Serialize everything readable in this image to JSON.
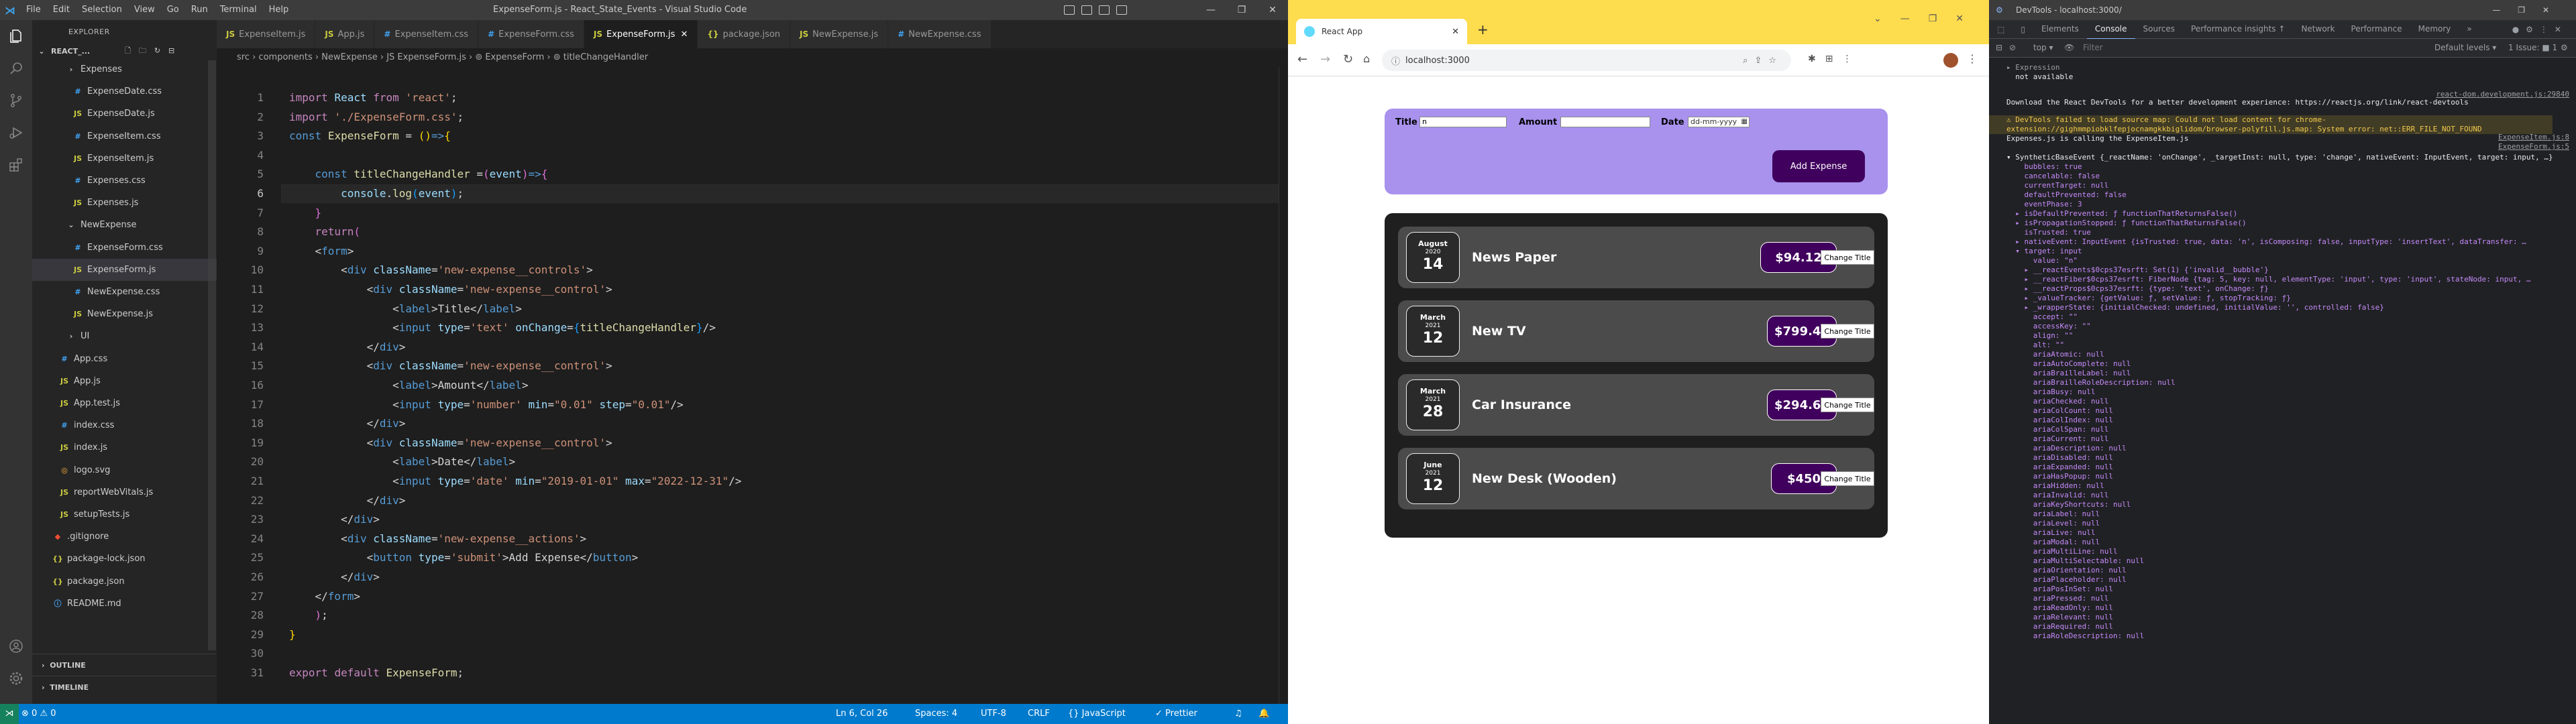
{
  "vscode": {
    "menus": [
      "File",
      "Edit",
      "Selection",
      "View",
      "Go",
      "Run",
      "Terminal",
      "Help"
    ],
    "title": "ExpenseForm.js - React_State_Events - Visual Studio Code",
    "explorer_title": "EXPLORER",
    "project": "REACT_...",
    "tree": [
      {
        "label": "Expenses",
        "type": "folder",
        "indent": 1
      },
      {
        "label": "ExpenseDate.css",
        "type": "css",
        "indent": 2
      },
      {
        "label": "ExpenseDate.js",
        "type": "js",
        "indent": 2
      },
      {
        "label": "ExpenseItem.css",
        "type": "css",
        "indent": 2
      },
      {
        "label": "ExpenseItem.js",
        "type": "js",
        "indent": 2
      },
      {
        "label": "Expenses.css",
        "type": "css",
        "indent": 2
      },
      {
        "label": "Expenses.js",
        "type": "js",
        "indent": 2
      },
      {
        "label": "NewExpense",
        "type": "folder-open",
        "indent": 1
      },
      {
        "label": "ExpenseForm.css",
        "type": "css",
        "indent": 2
      },
      {
        "label": "ExpenseForm.js",
        "type": "js",
        "indent": 2,
        "selected": true
      },
      {
        "label": "NewExpense.css",
        "type": "css",
        "indent": 2
      },
      {
        "label": "NewExpense.js",
        "type": "js",
        "indent": 2
      },
      {
        "label": "UI",
        "type": "folder",
        "indent": 1
      },
      {
        "label": "App.css",
        "type": "css",
        "indent": 0
      },
      {
        "label": "App.js",
        "type": "js",
        "indent": 0
      },
      {
        "label": "App.test.js",
        "type": "js",
        "indent": 0
      },
      {
        "label": "index.css",
        "type": "css",
        "indent": 0
      },
      {
        "label": "index.js",
        "type": "js",
        "indent": 0
      },
      {
        "label": "logo.svg",
        "type": "svg",
        "indent": 0
      },
      {
        "label": "reportWebVitals.js",
        "type": "js",
        "indent": 0
      },
      {
        "label": "setupTests.js",
        "type": "js",
        "indent": 0
      },
      {
        "label": ".gitignore",
        "type": "git",
        "indent": -1
      },
      {
        "label": "package-lock.json",
        "type": "json",
        "indent": -1
      },
      {
        "label": "package.json",
        "type": "json",
        "indent": -1
      },
      {
        "label": "README.md",
        "type": "md",
        "indent": -1
      }
    ],
    "outline": "OUTLINE",
    "timeline": "TIMELINE",
    "tabs": [
      {
        "label": "ExpenseItem.js",
        "type": "js"
      },
      {
        "label": "App.js",
        "type": "js"
      },
      {
        "label": "ExpenseItem.css",
        "type": "css"
      },
      {
        "label": "ExpenseForm.css",
        "type": "css"
      },
      {
        "label": "ExpenseForm.js",
        "type": "js",
        "active": true
      },
      {
        "label": "package.json",
        "type": "json"
      },
      {
        "label": "NewExpense.js",
        "type": "js"
      },
      {
        "label": "NewExpense.css",
        "type": "css"
      }
    ],
    "breadcrumb": "src › components › NewExpense › JS ExpenseForm.js › ⊚ ExpenseForm › ⊚ titleChangeHandler",
    "status": {
      "errors": "⊗ 0 ⚠ 0",
      "position": "Ln 6, Col 26",
      "spaces": "Spaces: 4",
      "encoding": "UTF-8",
      "eol": "CRLF",
      "language": "{} JavaScript",
      "prettier": "✓ Prettier"
    }
  },
  "chrome": {
    "tab_title": "React App",
    "url": "localhost:3000",
    "form": {
      "title_label": "Title",
      "title_value": "n",
      "amount_label": "Amount",
      "amount_value": "",
      "date_label": "Date",
      "date_value": "dd-mm-yyyy",
      "add_button": "Add Expense"
    },
    "expenses": [
      {
        "month": "August",
        "year": "2020",
        "day": "14",
        "title": "News Paper",
        "price": "$94.12",
        "button": "Change Title"
      },
      {
        "month": "March",
        "year": "2021",
        "day": "12",
        "title": "New TV",
        "price": "$799.49",
        "button": "Change Title"
      },
      {
        "month": "March",
        "year": "2021",
        "day": "28",
        "title": "Car Insurance",
        "price": "$294.67",
        "button": "Change Title"
      },
      {
        "month": "June",
        "year": "2021",
        "day": "12",
        "title": "New Desk (Wooden)",
        "price": "$450",
        "button": "Change Title"
      }
    ]
  },
  "devtools": {
    "title": "DevTools - localhost:3000/",
    "tabs": [
      "Elements",
      "Console",
      "Sources",
      "Performance insights ↑",
      "Network",
      "Performance",
      "Memory",
      "»"
    ],
    "active_tab": "Console",
    "filter": "Filter",
    "levels": "Default levels ▾",
    "issues": "1 Issue: ■ 1",
    "context": "top ▾",
    "lines": [
      {
        "text": "▸ Expression",
        "cls": "dk"
      },
      {
        "text": "  not available",
        "cls": "dv"
      },
      {
        "text": "",
        "cls": "dv"
      },
      {
        "text": "Download the React DevTools for a better development experience: https://reactjs.org/link/react-devtools",
        "cls": "dv",
        "link": "react-dom.development.js:29840"
      },
      {
        "text": "⚠ DevTools failed to load source map: Could not load content for chrome-extension://gighmmpiobklfepjocnamgkkbiglidom/browser-polyfill.js.map: System error: net::ERR_FILE_NOT_FOUND",
        "cls": "dsv"
      },
      {
        "text": "Expenses.js is calling the ExpenseItem.js",
        "cls": "dv",
        "link": "ExpenseItem.js:8"
      },
      {
        "text": "",
        "cls": "dv",
        "link": "ExpenseForm.js:5"
      },
      {
        "text": "▾ SyntheticBaseEvent {_reactName: 'onChange', _targetInst: null, type: 'change', nativeEvent: InputEvent, target: input, …}",
        "cls": "dv"
      },
      {
        "text": "    bubbles: true",
        "cls": "dpk"
      },
      {
        "text": "    cancelable: false",
        "cls": "dpk"
      },
      {
        "text": "    currentTarget: null",
        "cls": "dpk"
      },
      {
        "text": "    defaultPrevented: false",
        "cls": "dpk"
      },
      {
        "text": "    eventPhase: 3",
        "cls": "dpk"
      },
      {
        "text": "  ▸ isDefaultPrevented: ƒ functionThatReturnsFalse()",
        "cls": "dpk"
      },
      {
        "text": "  ▸ isPropagationStopped: ƒ functionThatReturnsFalse()",
        "cls": "dpk"
      },
      {
        "text": "    isTrusted: true",
        "cls": "dpk"
      },
      {
        "text": "  ▸ nativeEvent: InputEvent {isTrusted: true, data: 'n', isComposing: false, inputType: 'insertText', dataTransfer: …",
        "cls": "dpk"
      },
      {
        "text": "  ▾ target: input",
        "cls": "dpk"
      },
      {
        "text": "      value: \"n\"",
        "cls": "dpk"
      },
      {
        "text": "    ▸ __reactEvents$0cps37esrft: Set(1) {'invalid__bubble'}",
        "cls": "dpk"
      },
      {
        "text": "    ▸ __reactFiber$0cps37esrft: FiberNode {tag: 5, key: null, elementType: 'input', type: 'input', stateNode: input, …",
        "cls": "dpk"
      },
      {
        "text": "    ▸ __reactProps$0cps37esrft: {type: 'text', onChange: ƒ}",
        "cls": "dpk"
      },
      {
        "text": "    ▸ _valueTracker: {getValue: ƒ, setValue: ƒ, stopTracking: ƒ}",
        "cls": "dpk"
      },
      {
        "text": "    ▸ _wrapperState: {initialChecked: undefined, initialValue: '', controlled: false}",
        "cls": "dpk"
      },
      {
        "text": "      accept: \"\"",
        "cls": "dpk"
      },
      {
        "text": "      accessKey: \"\"",
        "cls": "dpk"
      },
      {
        "text": "      align: \"\"",
        "cls": "dpk"
      },
      {
        "text": "      alt: \"\"",
        "cls": "dpk"
      },
      {
        "text": "      ariaAtomic: null",
        "cls": "dpk"
      },
      {
        "text": "      ariaAutoComplete: null",
        "cls": "dpk"
      },
      {
        "text": "      ariaBrailleLabel: null",
        "cls": "dpk"
      },
      {
        "text": "      ariaBrailleRoleDescription: null",
        "cls": "dpk"
      },
      {
        "text": "      ariaBusy: null",
        "cls": "dpk"
      },
      {
        "text": "      ariaChecked: null",
        "cls": "dpk"
      },
      {
        "text": "      ariaColCount: null",
        "cls": "dpk"
      },
      {
        "text": "      ariaColIndex: null",
        "cls": "dpk"
      },
      {
        "text": "      ariaColSpan: null",
        "cls": "dpk"
      },
      {
        "text": "      ariaCurrent: null",
        "cls": "dpk"
      },
      {
        "text": "      ariaDescription: null",
        "cls": "dpk"
      },
      {
        "text": "      ariaDisabled: null",
        "cls": "dpk"
      },
      {
        "text": "      ariaExpanded: null",
        "cls": "dpk"
      },
      {
        "text": "      ariaHasPopup: null",
        "cls": "dpk"
      },
      {
        "text": "      ariaHidden: null",
        "cls": "dpk"
      },
      {
        "text": "      ariaInvalid: null",
        "cls": "dpk"
      },
      {
        "text": "      ariaKeyShortcuts: null",
        "cls": "dpk"
      },
      {
        "text": "      ariaLabel: null",
        "cls": "dpk"
      },
      {
        "text": "      ariaLevel: null",
        "cls": "dpk"
      },
      {
        "text": "      ariaLive: null",
        "cls": "dpk"
      },
      {
        "text": "      ariaModal: null",
        "cls": "dpk"
      },
      {
        "text": "      ariaMultiLine: null",
        "cls": "dpk"
      },
      {
        "text": "      ariaMultiSelectable: null",
        "cls": "dpk"
      },
      {
        "text": "      ariaOrientation: null",
        "cls": "dpk"
      },
      {
        "text": "      ariaPlaceholder: null",
        "cls": "dpk"
      },
      {
        "text": "      ariaPosInSet: null",
        "cls": "dpk"
      },
      {
        "text": "      ariaPressed: null",
        "cls": "dpk"
      },
      {
        "text": "      ariaReadOnly: null",
        "cls": "dpk"
      },
      {
        "text": "      ariaRelevant: null",
        "cls": "dpk"
      },
      {
        "text": "      ariaRequired: null",
        "cls": "dpk"
      },
      {
        "text": "      ariaRoleDescription: null",
        "cls": "dpk"
      }
    ]
  }
}
